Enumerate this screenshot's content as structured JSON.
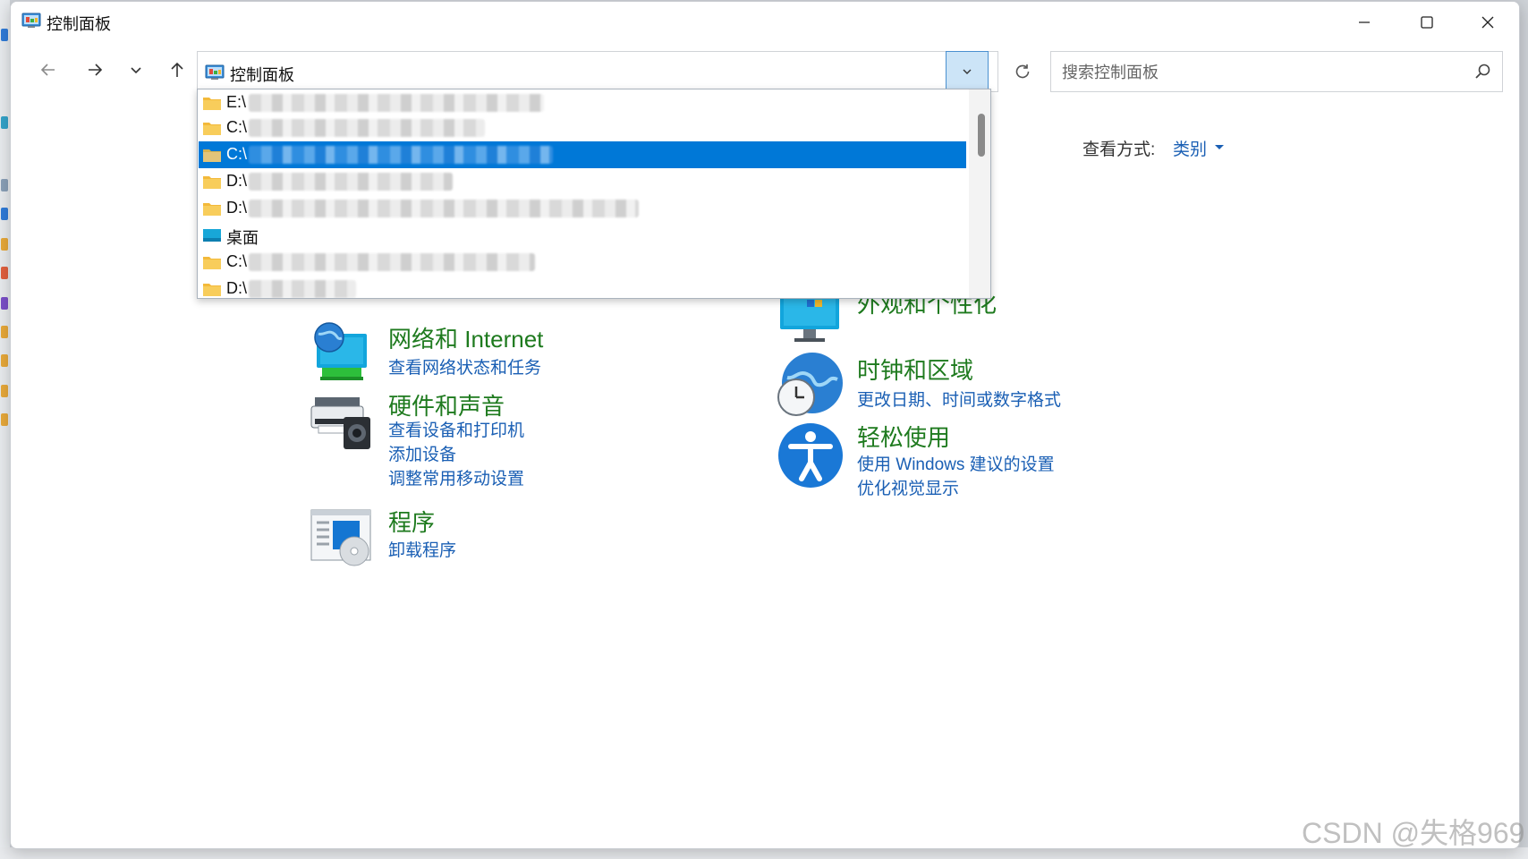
{
  "window": {
    "title": "控制面板"
  },
  "address": {
    "path": "控制面板"
  },
  "search": {
    "placeholder": "搜索控制面板"
  },
  "view_by": {
    "label": "查看方式:",
    "value": "类别"
  },
  "history_dropdown": {
    "items": [
      {
        "label": "E:\\",
        "icon": "folder-icon",
        "selected": false
      },
      {
        "label": "C:\\",
        "icon": "folder-icon",
        "selected": false
      },
      {
        "label": "C:\\",
        "icon": "folder-icon",
        "selected": true
      },
      {
        "label": "D:\\",
        "icon": "folder-icon",
        "selected": false
      },
      {
        "label": "D:\\",
        "icon": "folder-icon",
        "selected": false
      },
      {
        "label": "桌面",
        "icon": "desktop-icon",
        "selected": false
      },
      {
        "label": "C:\\",
        "icon": "folder-icon",
        "selected": false
      },
      {
        "label": "D:\\",
        "icon": "folder-icon",
        "selected": false
      }
    ]
  },
  "categories": {
    "network": {
      "title": "网络和 Internet",
      "links": [
        "查看网络状态和任务"
      ]
    },
    "hardware": {
      "title": "硬件和声音",
      "links": [
        "查看设备和打印机",
        "添加设备",
        "调整常用移动设置"
      ]
    },
    "programs": {
      "title": "程序",
      "links": [
        "卸载程序"
      ]
    },
    "appearance": {
      "title": "外观和个性化",
      "links": []
    },
    "clock": {
      "title": "时钟和区域",
      "links": [
        "更改日期、时间或数字格式"
      ]
    },
    "ease": {
      "title": "轻松使用",
      "links": [
        "使用 Windows 建议的设置",
        "优化视觉显示"
      ]
    }
  },
  "watermark": "CSDN @失格969",
  "colors": {
    "accent": "#0078d7",
    "category_title": "#1e7a1e",
    "link": "#1a5fb4"
  }
}
